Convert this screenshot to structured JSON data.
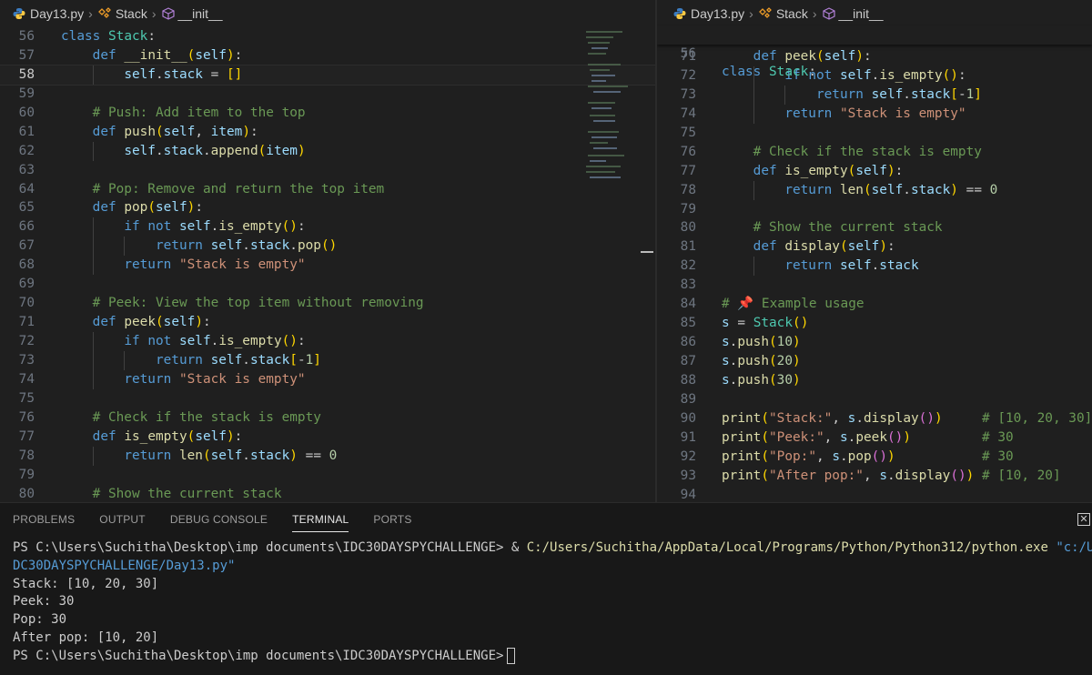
{
  "breadcrumb": {
    "file": "Day13.py",
    "class": "Stack",
    "method": "__init__"
  },
  "left_editor": {
    "active_line": 58,
    "lines": [
      {
        "n": "56",
        "text": "class Stack:"
      },
      {
        "n": "57",
        "text": "    def __init__(self):"
      },
      {
        "n": "58",
        "text": "        self.stack = []"
      },
      {
        "n": "59",
        "text": ""
      },
      {
        "n": "60",
        "text": "    # Push: Add item to the top"
      },
      {
        "n": "61",
        "text": "    def push(self, item):"
      },
      {
        "n": "62",
        "text": "        self.stack.append(item)"
      },
      {
        "n": "63",
        "text": ""
      },
      {
        "n": "64",
        "text": "    # Pop: Remove and return the top item"
      },
      {
        "n": "65",
        "text": "    def pop(self):"
      },
      {
        "n": "66",
        "text": "        if not self.is_empty():"
      },
      {
        "n": "67",
        "text": "            return self.stack.pop()"
      },
      {
        "n": "68",
        "text": "        return \"Stack is empty\""
      },
      {
        "n": "69",
        "text": ""
      },
      {
        "n": "70",
        "text": "    # Peek: View the top item without removing"
      },
      {
        "n": "71",
        "text": "    def peek(self):"
      },
      {
        "n": "72",
        "text": "        if not self.is_empty():"
      },
      {
        "n": "73",
        "text": "            return self.stack[-1]"
      },
      {
        "n": "74",
        "text": "        return \"Stack is empty\""
      },
      {
        "n": "75",
        "text": ""
      },
      {
        "n": "76",
        "text": "    # Check if the stack is empty"
      },
      {
        "n": "77",
        "text": "    def is_empty(self):"
      },
      {
        "n": "78",
        "text": "        return len(self.stack) == 0"
      },
      {
        "n": "79",
        "text": ""
      },
      {
        "n": "80",
        "text": "    # Show the current stack"
      }
    ]
  },
  "right_editor": {
    "sticky": {
      "n": "56",
      "text": "class Stack:"
    },
    "lines": [
      {
        "n": "71",
        "text": "    def peek(self):"
      },
      {
        "n": "72",
        "text": "        if not self.is_empty():"
      },
      {
        "n": "73",
        "text": "            return self.stack[-1]"
      },
      {
        "n": "74",
        "text": "        return \"Stack is empty\""
      },
      {
        "n": "75",
        "text": ""
      },
      {
        "n": "76",
        "text": "    # Check if the stack is empty"
      },
      {
        "n": "77",
        "text": "    def is_empty(self):"
      },
      {
        "n": "78",
        "text": "        return len(self.stack) == 0"
      },
      {
        "n": "79",
        "text": ""
      },
      {
        "n": "80",
        "text": "    # Show the current stack"
      },
      {
        "n": "81",
        "text": "    def display(self):"
      },
      {
        "n": "82",
        "text": "        return self.stack"
      },
      {
        "n": "83",
        "text": ""
      },
      {
        "n": "84",
        "text": "# 📌 Example usage"
      },
      {
        "n": "85",
        "text": "s = Stack()"
      },
      {
        "n": "86",
        "text": "s.push(10)"
      },
      {
        "n": "87",
        "text": "s.push(20)"
      },
      {
        "n": "88",
        "text": "s.push(30)"
      },
      {
        "n": "89",
        "text": ""
      },
      {
        "n": "90",
        "text": "print(\"Stack:\", s.display())     # [10, 20, 30]"
      },
      {
        "n": "91",
        "text": "print(\"Peek:\", s.peek())         # 30"
      },
      {
        "n": "92",
        "text": "print(\"Pop:\", s.pop())           # 30"
      },
      {
        "n": "93",
        "text": "print(\"After pop:\", s.display()) # [10, 20]"
      },
      {
        "n": "94",
        "text": ""
      }
    ]
  },
  "panel": {
    "tabs": [
      "PROBLEMS",
      "OUTPUT",
      "DEBUG CONSOLE",
      "TERMINAL",
      "PORTS"
    ],
    "active_tab": "TERMINAL"
  },
  "terminal": {
    "prompt": "PS C:\\Users\\Suchitha\\Desktop\\imp documents\\IDC30DAYSPYCHALLENGE> ",
    "command_amp": "& ",
    "command_exe": "C:/Users/Suchitha/AppData/Local/Programs/Python/Python312/python.exe",
    "command_arg_start": " \"c:/Users/Such",
    "command_arg_cont": "DC30DAYSPYCHALLENGE/Day13.py\"",
    "output": [
      "Stack: [10, 20, 30]",
      "Peek: 30",
      "Pop: 30",
      "After pop: [10, 20]"
    ],
    "final_prompt": "PS C:\\Users\\Suchitha\\Desktop\\imp documents\\IDC30DAYSPYCHALLENGE>"
  },
  "colors": {
    "keyword": "#569cd6",
    "function": "#dcdcaa",
    "class": "#4ec9b0",
    "string": "#ce9178",
    "comment": "#6a9955",
    "number": "#b5cea8"
  }
}
